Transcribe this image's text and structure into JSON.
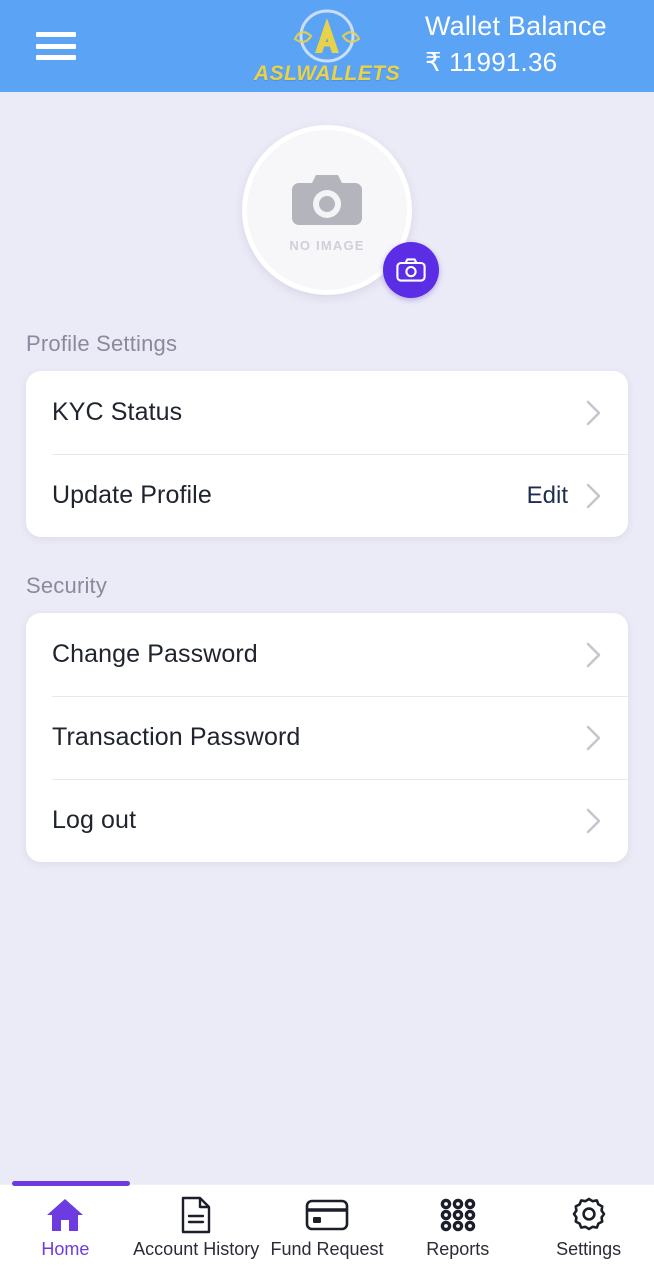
{
  "header": {
    "menu_icon": "hamburger-menu-icon",
    "logo": {
      "letter": "A",
      "brand": "ASLWALLETS",
      "color": "#e8d24a"
    },
    "balance_label": "Wallet Balance",
    "balance_value": "₹ 11991.36",
    "background": "#5ba3f5"
  },
  "profile": {
    "avatar_placeholder_icon": "camera-icon",
    "avatar_placeholder_text": "NO IMAGE",
    "camera_button_icon": "camera-icon",
    "camera_button_color": "#5b2ee5"
  },
  "sections": [
    {
      "title": "Profile Settings",
      "rows": [
        {
          "label": "KYC Status",
          "action": ""
        },
        {
          "label": "Update Profile",
          "action": "Edit"
        }
      ]
    },
    {
      "title": "Security",
      "rows": [
        {
          "label": "Change Password",
          "action": ""
        },
        {
          "label": "Transaction Password",
          "action": ""
        },
        {
          "label": "Log out",
          "action": ""
        }
      ]
    }
  ],
  "bottom_nav": {
    "active_index": 0,
    "active_color": "#6c3ce0",
    "items": [
      {
        "label": "Home",
        "icon": "home-icon"
      },
      {
        "label": "Account History",
        "icon": "document-icon"
      },
      {
        "label": "Fund Request",
        "icon": "credit-card-icon"
      },
      {
        "label": "Reports",
        "icon": "grid-dots-icon"
      },
      {
        "label": "Settings",
        "icon": "gear-icon"
      }
    ]
  }
}
